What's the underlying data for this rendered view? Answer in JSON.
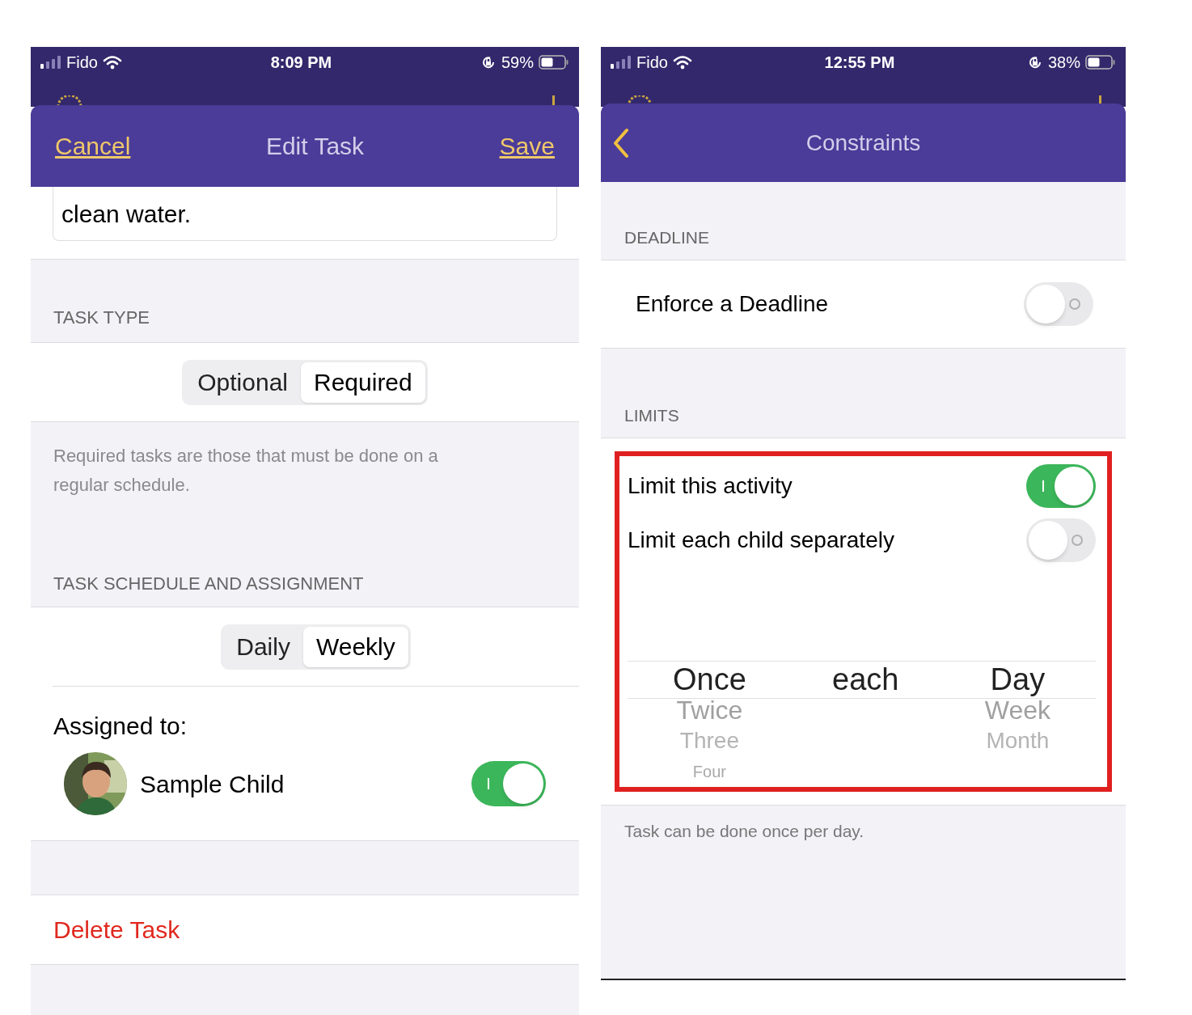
{
  "edit_task": {
    "status_bar": {
      "carrier": "Fido",
      "time": "8:09 PM",
      "battery": "59%"
    },
    "nav": {
      "cancel": "Cancel",
      "title": "Edit Task",
      "save": "Save"
    },
    "description": {
      "value": "clean water."
    },
    "task_type": {
      "header": "TASK TYPE",
      "options": [
        {
          "label": "Optional",
          "selected": false
        },
        {
          "label": "Required",
          "selected": true
        }
      ],
      "footer": "Required tasks are those that must be done on a regular schedule."
    },
    "schedule": {
      "header": "TASK SCHEDULE AND ASSIGNMENT",
      "options": [
        {
          "label": "Daily",
          "selected": false
        },
        {
          "label": "Weekly",
          "selected": true
        }
      ],
      "assigned_label": "Assigned to:",
      "assignees": [
        {
          "name": "Sample Child",
          "on": true
        }
      ]
    },
    "delete": "Delete Task"
  },
  "constraints": {
    "status_bar": {
      "carrier": "Fido",
      "time": "12:55 PM",
      "battery": "38%"
    },
    "nav": {
      "title": "Constraints"
    },
    "deadline": {
      "header": "DEADLINE",
      "toggles": [
        {
          "label": "Enforce a Deadline",
          "on": false
        }
      ]
    },
    "limits": {
      "header": "LIMITS",
      "highlighted": true,
      "toggles": [
        {
          "label": "Limit this activity",
          "on": true
        },
        {
          "label": "Limit each child separately",
          "on": false
        }
      ],
      "picker": {
        "columns": [
          {
            "items": [
              {
                "label": "Once",
                "selected": true
              },
              {
                "label": "Twice",
                "selected": false
              },
              {
                "label": "Three",
                "selected": false
              },
              {
                "label": "Four",
                "selected": false
              }
            ]
          },
          {
            "items": [
              {
                "label": "each",
                "selected": true
              }
            ]
          },
          {
            "items": [
              {
                "label": "Day",
                "selected": true
              },
              {
                "label": "Week",
                "selected": false
              },
              {
                "label": "Month",
                "selected": false
              }
            ]
          }
        ]
      },
      "footer": "Task can be done once per day."
    }
  }
}
